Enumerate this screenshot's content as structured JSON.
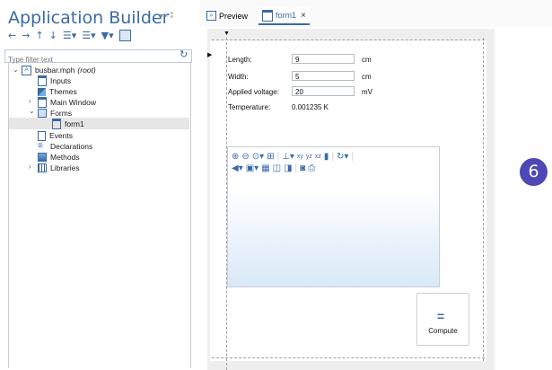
{
  "builder": {
    "title": "Application Builder",
    "panel_controls": "▾ ▫ ⁑",
    "filter_placeholder": "Type filter text",
    "tree": {
      "root": "busbar.mph",
      "root_suffix": "(root)",
      "items": [
        "Inputs",
        "Themes",
        "Main Window",
        "Forms",
        "form1",
        "Events",
        "Declarations",
        "Methods",
        "Libraries"
      ]
    }
  },
  "tabs": [
    {
      "label": "Preview"
    },
    {
      "label": "form1",
      "close": "×"
    }
  ],
  "form": {
    "rows": [
      {
        "label": "Length:",
        "value": "9",
        "unit": "cm"
      },
      {
        "label": "Width:",
        "value": "5",
        "unit": "cm"
      },
      {
        "label": "Applied voltage:",
        "value": "20",
        "unit": "mV"
      }
    ],
    "temperature_label": "Temperature:",
    "temperature_value": "0.001235 K",
    "compute_label": "Compute"
  },
  "badge": {
    "number": "6",
    "color": "#4d48b5"
  },
  "colors": {
    "accent": "#3a6aa6",
    "selected_row": "#e6e6e6",
    "canvas": "#eeeeee"
  }
}
